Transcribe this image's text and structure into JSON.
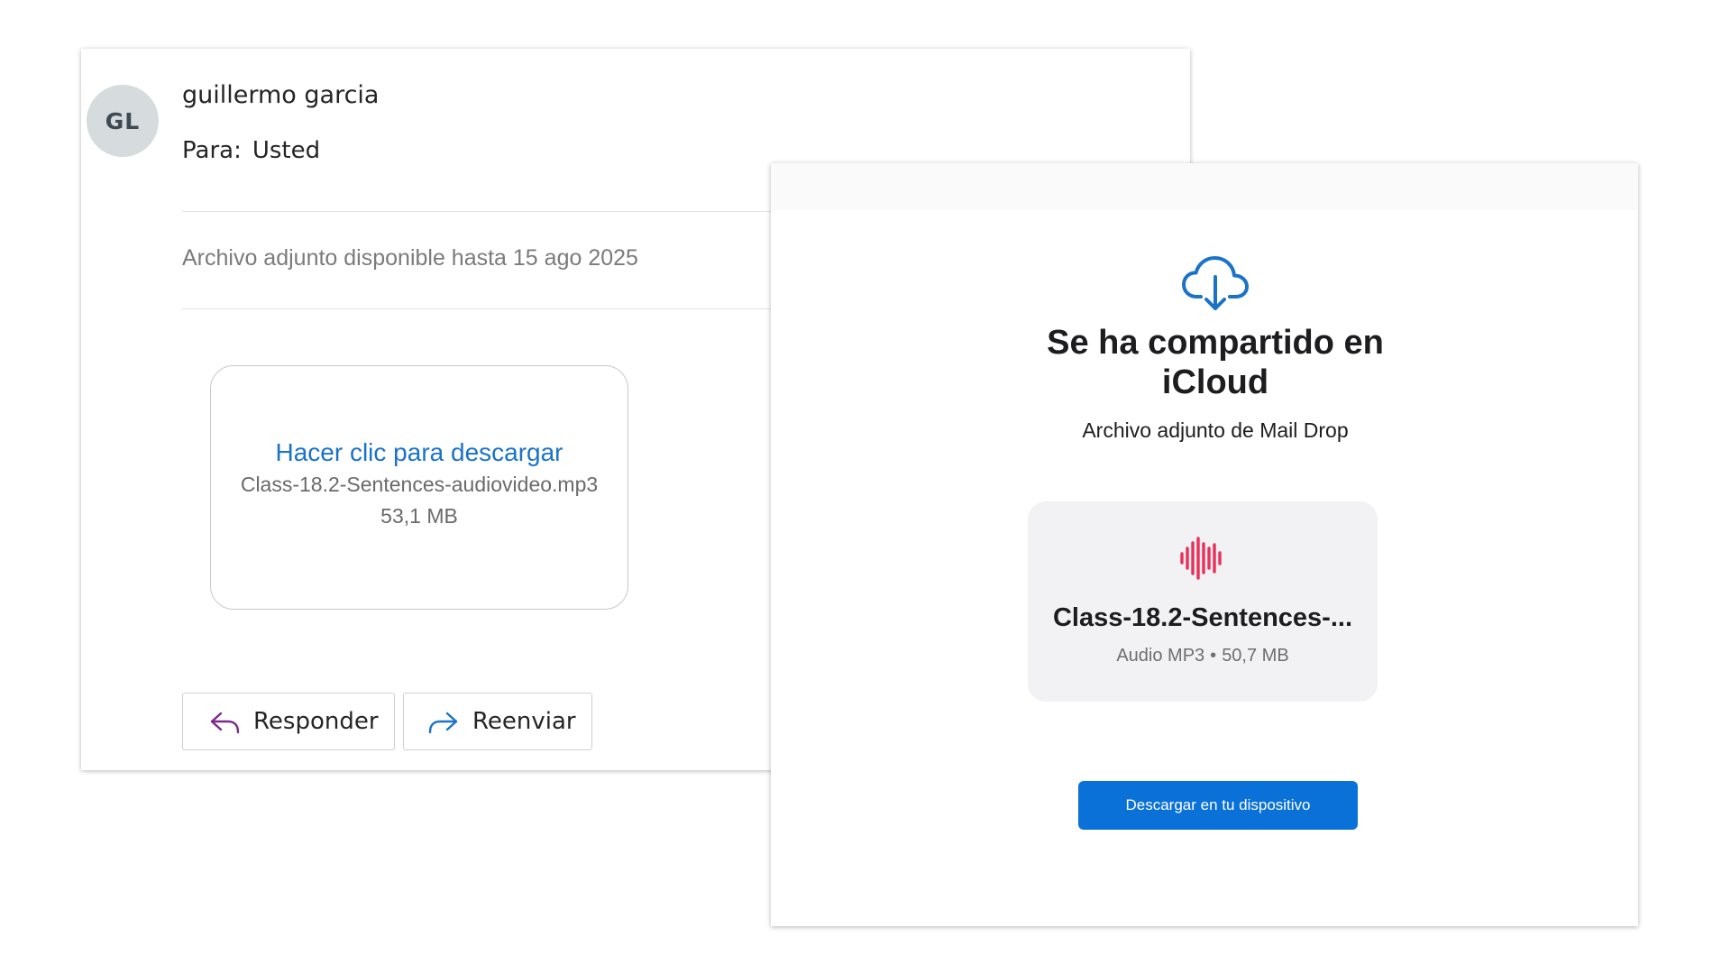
{
  "email": {
    "avatar_initials": "GL",
    "sender_name": "guillermo garcia",
    "to_label": "Para:",
    "to_value": "Usted",
    "availability_notice": "Archivo adjunto disponible hasta 15 ago 2025",
    "download_link": "Hacer clic para descargar",
    "attachment_filename": "Class-18.2-Sentences-audiovideo.mp3",
    "attachment_size": "53,1 MB",
    "reply_label": "Responder",
    "forward_label": "Reenviar",
    "icons": {
      "reply": "reply-arrow-icon",
      "forward": "forward-arrow-icon"
    },
    "colors": {
      "link": "#1a73c9",
      "reply_icon": "#7a2a8a",
      "forward_icon": "#1a73c9",
      "avatar_bg": "#d6dbdd"
    }
  },
  "icloud": {
    "title": "Se ha compartido en iCloud",
    "subtitle": "Archivo adjunto de Mail Drop",
    "file_name": "Class-18.2-Sentences-...",
    "file_type": "Audio MP3",
    "separator": "•",
    "file_size": "50,7 MB",
    "download_button": "Descargar en tu dispositivo",
    "icons": {
      "cloud": "cloud-download-icon",
      "file": "audio-waveform-icon"
    },
    "colors": {
      "cloud_icon": "#1a73c9",
      "waveform": "#e8305a",
      "button_bg": "#0a71d8",
      "card_bg": "#f2f2f4"
    }
  }
}
